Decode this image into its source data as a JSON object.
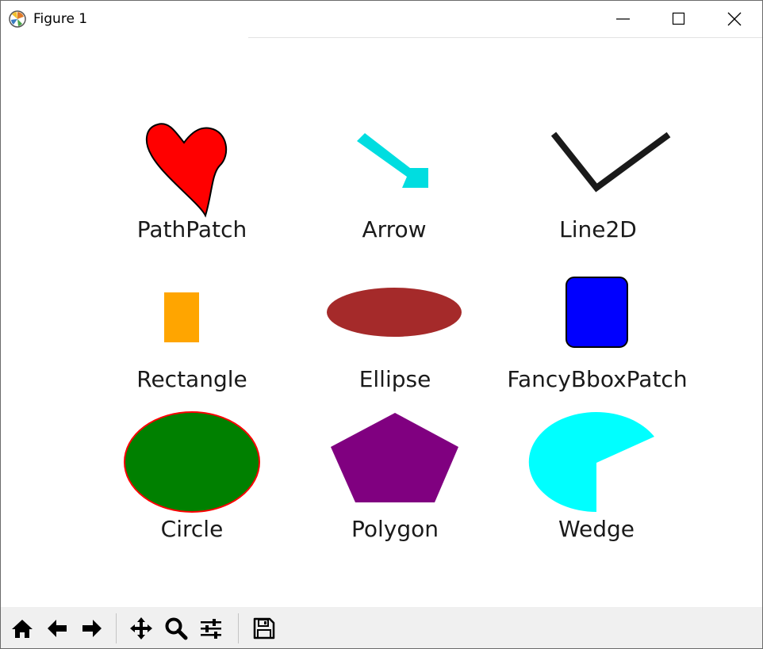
{
  "window": {
    "title": "Figure 1",
    "controls": [
      "minimize",
      "maximize",
      "close"
    ]
  },
  "figure": {
    "artists": [
      {
        "label": "PathPatch",
        "facecolor": "#ff0000",
        "edgecolor": "#000000"
      },
      {
        "label": "Arrow",
        "facecolor": "#00dde0"
      },
      {
        "label": "Line2D",
        "color": "#1a1a1a"
      },
      {
        "label": "Rectangle",
        "facecolor": "#ffa500"
      },
      {
        "label": "Ellipse",
        "facecolor": "#a52a2a"
      },
      {
        "label": "FancyBboxPatch",
        "facecolor": "#0000ff",
        "edgecolor": "#000000"
      },
      {
        "label": "Circle",
        "facecolor": "#008000",
        "edgecolor": "#ff0000"
      },
      {
        "label": "Polygon",
        "facecolor": "#800080"
      },
      {
        "label": "Wedge",
        "facecolor": "#00ffff"
      }
    ]
  },
  "toolbar": {
    "buttons": [
      "home",
      "back",
      "forward",
      "pan",
      "zoom",
      "configure-subplots",
      "save"
    ]
  }
}
